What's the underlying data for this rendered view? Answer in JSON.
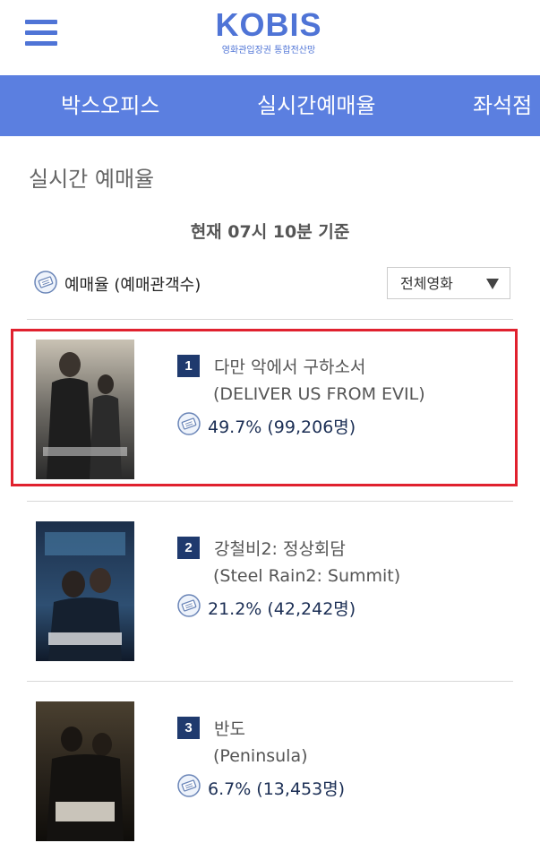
{
  "header": {
    "logo": "KOBIS",
    "logo_sub": "영화관입장권 통합전산망"
  },
  "nav": {
    "tabs": [
      {
        "label": "박스오피스"
      },
      {
        "label": "실시간예매율"
      },
      {
        "label": "좌석점"
      }
    ]
  },
  "page": {
    "title": "실시간 예매율",
    "basis": "현재 07시 10분  기준",
    "legend": "예매율 (예매관객수)",
    "filter_selected": "전체영화"
  },
  "movies": [
    {
      "rank": "1",
      "title_ko": "다만 악에서 구하소서",
      "title_en": "(DELIVER US FROM EVIL)",
      "rate": "49.7% (99,206명)"
    },
    {
      "rank": "2",
      "title_ko": "강철비2: 정상회담",
      "title_en": "(Steel Rain2: Summit)",
      "rate": "21.2% (42,242명)"
    },
    {
      "rank": "3",
      "title_ko": "반도",
      "title_en": "(Peninsula)",
      "rate": "6.7% (13,453명)"
    }
  ],
  "colors": {
    "brand": "#4f74d6",
    "nav_bg": "#5b7fe0",
    "rank_badge": "#1f3a6e",
    "highlight_border": "#e0212e"
  },
  "icons": {
    "menu": "hamburger-menu-icon",
    "ticket": "ticket-icon",
    "dropdown": "triangle-down-icon"
  }
}
